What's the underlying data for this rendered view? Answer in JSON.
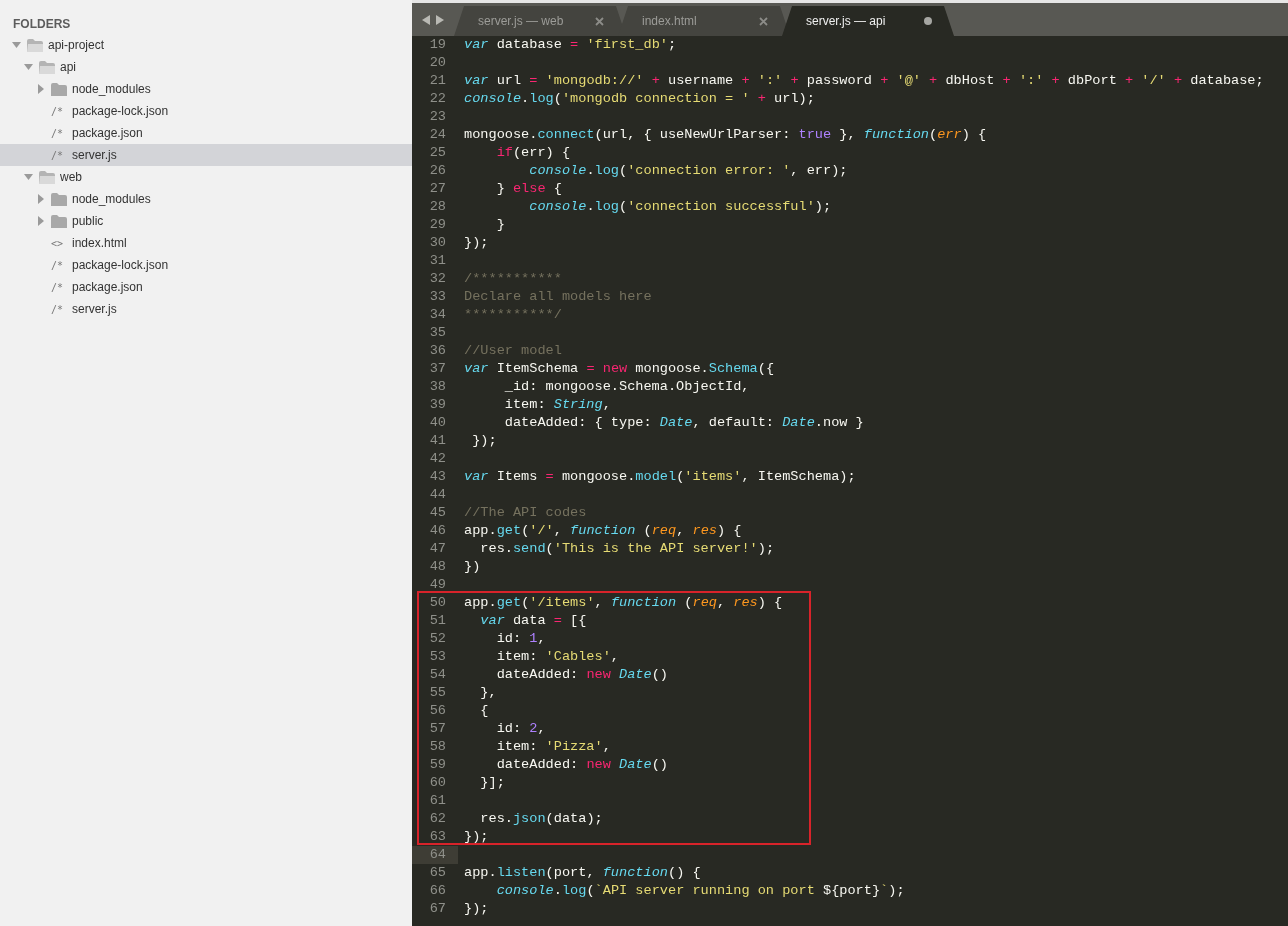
{
  "sidebar": {
    "heading": "FOLDERS",
    "tree": [
      {
        "label": "api-project",
        "kind": "folder",
        "expanded": true,
        "selected": false,
        "children": [
          {
            "label": "api",
            "kind": "folder",
            "expanded": true,
            "selected": false,
            "children": [
              {
                "label": "node_modules",
                "kind": "folder",
                "expanded": false,
                "selected": false
              },
              {
                "label": "package-lock.json",
                "kind": "file",
                "glyph": "/*",
                "selected": false
              },
              {
                "label": "package.json",
                "kind": "file",
                "glyph": "/*",
                "selected": false
              },
              {
                "label": "server.js",
                "kind": "file",
                "glyph": "/*",
                "selected": true
              }
            ]
          },
          {
            "label": "web",
            "kind": "folder",
            "expanded": true,
            "selected": false,
            "children": [
              {
                "label": "node_modules",
                "kind": "folder",
                "expanded": false,
                "selected": false
              },
              {
                "label": "public",
                "kind": "folder",
                "expanded": false,
                "selected": false
              },
              {
                "label": "index.html",
                "kind": "file",
                "glyph": "<>",
                "selected": false
              },
              {
                "label": "package-lock.json",
                "kind": "file",
                "glyph": "/*",
                "selected": false
              },
              {
                "label": "package.json",
                "kind": "file",
                "glyph": "/*",
                "selected": false
              },
              {
                "label": "server.js",
                "kind": "file",
                "glyph": "/*",
                "selected": false
              }
            ]
          }
        ]
      }
    ]
  },
  "tabs": [
    {
      "label": "server.js — web",
      "selected": false,
      "modified": false
    },
    {
      "label": "index.html",
      "selected": false,
      "modified": false
    },
    {
      "label": "server.js — api",
      "selected": true,
      "modified": true
    }
  ],
  "editor": {
    "lines": [
      {
        "number": "19",
        "current": false,
        "tokens": [
          {
            "text": "var",
            "kind": "storage"
          },
          {
            "text": " database ",
            "kind": "plain"
          },
          {
            "text": "=",
            "kind": "keyword"
          },
          {
            "text": " 'first_db'",
            "kind": "string"
          },
          {
            "text": ";",
            "kind": "plain"
          }
        ]
      },
      {
        "number": "20",
        "current": false
      },
      {
        "number": "21",
        "current": false,
        "tokens": [
          {
            "text": "var",
            "kind": "storage"
          },
          {
            "text": " url ",
            "kind": "plain"
          },
          {
            "text": "=",
            "kind": "keyword"
          },
          {
            "text": " 'mongodb://' ",
            "kind": "string"
          },
          {
            "text": "+",
            "kind": "keyword"
          },
          {
            "text": " username ",
            "kind": "plain"
          },
          {
            "text": "+",
            "kind": "keyword"
          },
          {
            "text": " ':' ",
            "kind": "string"
          },
          {
            "text": "+",
            "kind": "keyword"
          },
          {
            "text": " password ",
            "kind": "plain"
          },
          {
            "text": "+",
            "kind": "keyword"
          },
          {
            "text": " '@' ",
            "kind": "string"
          },
          {
            "text": "+",
            "kind": "keyword"
          },
          {
            "text": " dbHost ",
            "kind": "plain"
          },
          {
            "text": "+",
            "kind": "keyword"
          },
          {
            "text": " ':' ",
            "kind": "string"
          },
          {
            "text": "+",
            "kind": "keyword"
          },
          {
            "text": " dbPort ",
            "kind": "plain"
          },
          {
            "text": "+",
            "kind": "keyword"
          },
          {
            "text": " '/' ",
            "kind": "string"
          },
          {
            "text": "+",
            "kind": "keyword"
          },
          {
            "text": " database;",
            "kind": "plain"
          }
        ]
      },
      {
        "number": "22",
        "current": false,
        "tokens": [
          {
            "text": "console",
            "kind": "type"
          },
          {
            "text": ".",
            "kind": "plain"
          },
          {
            "text": "log",
            "kind": "support"
          },
          {
            "text": "(",
            "kind": "plain"
          },
          {
            "text": "'mongodb connection = ' ",
            "kind": "string"
          },
          {
            "text": "+",
            "kind": "keyword"
          },
          {
            "text": " url);",
            "kind": "plain"
          }
        ]
      },
      {
        "number": "23",
        "current": false
      },
      {
        "number": "24",
        "current": false,
        "tokens": [
          {
            "text": "mongoose.",
            "kind": "plain"
          },
          {
            "text": "connect",
            "kind": "support"
          },
          {
            "text": "(url, { useNewUrlParser: ",
            "kind": "plain"
          },
          {
            "text": "true",
            "kind": "constant"
          },
          {
            "text": " }, ",
            "kind": "plain"
          },
          {
            "text": "function",
            "kind": "type"
          },
          {
            "text": "(",
            "kind": "plain"
          },
          {
            "text": "err",
            "kind": "param"
          },
          {
            "text": ") {",
            "kind": "plain"
          }
        ]
      },
      {
        "number": "25",
        "current": false,
        "tokens": [
          {
            "text": "    if",
            "kind": "keyword"
          },
          {
            "text": "(err) {",
            "kind": "plain"
          }
        ]
      },
      {
        "number": "26",
        "current": false,
        "tokens": [
          {
            "text": "        console",
            "kind": "type"
          },
          {
            "text": ".",
            "kind": "plain"
          },
          {
            "text": "log",
            "kind": "support"
          },
          {
            "text": "(",
            "kind": "plain"
          },
          {
            "text": "'connection error: '",
            "kind": "string"
          },
          {
            "text": ", err);",
            "kind": "plain"
          }
        ]
      },
      {
        "number": "27",
        "current": false,
        "tokens": [
          {
            "text": "    } ",
            "kind": "plain"
          },
          {
            "text": "else",
            "kind": "keyword"
          },
          {
            "text": " {",
            "kind": "plain"
          }
        ]
      },
      {
        "number": "28",
        "current": false,
        "tokens": [
          {
            "text": "        console",
            "kind": "type"
          },
          {
            "text": ".",
            "kind": "plain"
          },
          {
            "text": "log",
            "kind": "support"
          },
          {
            "text": "(",
            "kind": "plain"
          },
          {
            "text": "'connection successful'",
            "kind": "string"
          },
          {
            "text": ");",
            "kind": "plain"
          }
        ]
      },
      {
        "number": "29",
        "current": false,
        "tokens": [
          {
            "text": "    }",
            "kind": "plain"
          }
        ]
      },
      {
        "number": "30",
        "current": false,
        "tokens": [
          {
            "text": "});",
            "kind": "plain"
          }
        ]
      },
      {
        "number": "31",
        "current": false
      },
      {
        "number": "32",
        "current": false,
        "tokens": [
          {
            "text": "/***********",
            "kind": "comment"
          }
        ]
      },
      {
        "number": "33",
        "current": false,
        "tokens": [
          {
            "text": "Declare all models here",
            "kind": "comment"
          }
        ]
      },
      {
        "number": "34",
        "current": false,
        "tokens": [
          {
            "text": "***********/",
            "kind": "comment"
          }
        ]
      },
      {
        "number": "35",
        "current": false
      },
      {
        "number": "36",
        "current": false,
        "tokens": [
          {
            "text": "//User model",
            "kind": "comment"
          }
        ]
      },
      {
        "number": "37",
        "current": false,
        "tokens": [
          {
            "text": "var",
            "kind": "storage"
          },
          {
            "text": " ItemSchema ",
            "kind": "plain"
          },
          {
            "text": "=",
            "kind": "keyword"
          },
          {
            "text": " new",
            "kind": "keyword"
          },
          {
            "text": " mongoose.",
            "kind": "plain"
          },
          {
            "text": "Schema",
            "kind": "support"
          },
          {
            "text": "({",
            "kind": "plain"
          }
        ]
      },
      {
        "number": "38",
        "current": false,
        "tokens": [
          {
            "text": "     _id: mongoose.Schema.ObjectId,",
            "kind": "plain"
          }
        ]
      },
      {
        "number": "39",
        "current": false,
        "tokens": [
          {
            "text": "     item: ",
            "kind": "plain"
          },
          {
            "text": "String",
            "kind": "type"
          },
          {
            "text": ",",
            "kind": "plain"
          }
        ]
      },
      {
        "number": "40",
        "current": false,
        "tokens": [
          {
            "text": "     dateAdded: { type: ",
            "kind": "plain"
          },
          {
            "text": "Date",
            "kind": "type"
          },
          {
            "text": ", default: ",
            "kind": "plain"
          },
          {
            "text": "Date",
            "kind": "type"
          },
          {
            "text": ".now }",
            "kind": "plain"
          }
        ]
      },
      {
        "number": "41",
        "current": false,
        "tokens": [
          {
            "text": " });",
            "kind": "plain"
          }
        ]
      },
      {
        "number": "42",
        "current": false
      },
      {
        "number": "43",
        "current": false,
        "tokens": [
          {
            "text": "var",
            "kind": "storage"
          },
          {
            "text": " Items ",
            "kind": "plain"
          },
          {
            "text": "=",
            "kind": "keyword"
          },
          {
            "text": " mongoose.",
            "kind": "plain"
          },
          {
            "text": "model",
            "kind": "support"
          },
          {
            "text": "(",
            "kind": "plain"
          },
          {
            "text": "'items'",
            "kind": "string"
          },
          {
            "text": ", ItemSchema);",
            "kind": "plain"
          }
        ]
      },
      {
        "number": "44",
        "current": false
      },
      {
        "number": "45",
        "current": false,
        "tokens": [
          {
            "text": "//The API codes",
            "kind": "comment"
          }
        ]
      },
      {
        "number": "46",
        "current": false,
        "tokens": [
          {
            "text": "app.",
            "kind": "plain"
          },
          {
            "text": "get",
            "kind": "support"
          },
          {
            "text": "(",
            "kind": "plain"
          },
          {
            "text": "'/'",
            "kind": "string"
          },
          {
            "text": ", ",
            "kind": "plain"
          },
          {
            "text": "function",
            "kind": "type"
          },
          {
            "text": " (",
            "kind": "plain"
          },
          {
            "text": "req",
            "kind": "param"
          },
          {
            "text": ", ",
            "kind": "plain"
          },
          {
            "text": "res",
            "kind": "param"
          },
          {
            "text": ") {",
            "kind": "plain"
          }
        ]
      },
      {
        "number": "47",
        "current": false,
        "tokens": [
          {
            "text": "  res.",
            "kind": "plain"
          },
          {
            "text": "send",
            "kind": "support"
          },
          {
            "text": "(",
            "kind": "plain"
          },
          {
            "text": "'This is the API server!'",
            "kind": "string"
          },
          {
            "text": ");",
            "kind": "plain"
          }
        ]
      },
      {
        "number": "48",
        "current": false,
        "tokens": [
          {
            "text": "})",
            "kind": "plain"
          }
        ]
      },
      {
        "number": "49",
        "current": false
      },
      {
        "number": "50",
        "current": false,
        "tokens": [
          {
            "text": "app.",
            "kind": "plain"
          },
          {
            "text": "get",
            "kind": "support"
          },
          {
            "text": "(",
            "kind": "plain"
          },
          {
            "text": "'/items'",
            "kind": "string"
          },
          {
            "text": ", ",
            "kind": "plain"
          },
          {
            "text": "function",
            "kind": "type"
          },
          {
            "text": " (",
            "kind": "plain"
          },
          {
            "text": "req",
            "kind": "param"
          },
          {
            "text": ", ",
            "kind": "plain"
          },
          {
            "text": "res",
            "kind": "param"
          },
          {
            "text": ") {",
            "kind": "plain"
          }
        ]
      },
      {
        "number": "51",
        "current": false,
        "tokens": [
          {
            "text": "  var",
            "kind": "storage"
          },
          {
            "text": " data ",
            "kind": "plain"
          },
          {
            "text": "=",
            "kind": "keyword"
          },
          {
            "text": " [{",
            "kind": "plain"
          }
        ]
      },
      {
        "number": "52",
        "current": false,
        "tokens": [
          {
            "text": "    id: ",
            "kind": "plain"
          },
          {
            "text": "1",
            "kind": "constant"
          },
          {
            "text": ",",
            "kind": "plain"
          }
        ]
      },
      {
        "number": "53",
        "current": false,
        "tokens": [
          {
            "text": "    item: ",
            "kind": "plain"
          },
          {
            "text": "'Cables'",
            "kind": "string"
          },
          {
            "text": ",",
            "kind": "plain"
          }
        ]
      },
      {
        "number": "54",
        "current": false,
        "tokens": [
          {
            "text": "    dateAdded: ",
            "kind": "plain"
          },
          {
            "text": "new",
            "kind": "keyword"
          },
          {
            "text": " Date",
            "kind": "type"
          },
          {
            "text": "()",
            "kind": "plain"
          }
        ]
      },
      {
        "number": "55",
        "current": false,
        "tokens": [
          {
            "text": "  },",
            "kind": "plain"
          }
        ]
      },
      {
        "number": "56",
        "current": false,
        "tokens": [
          {
            "text": "  {",
            "kind": "plain"
          }
        ]
      },
      {
        "number": "57",
        "current": false,
        "tokens": [
          {
            "text": "    id: ",
            "kind": "plain"
          },
          {
            "text": "2",
            "kind": "constant"
          },
          {
            "text": ",",
            "kind": "plain"
          }
        ]
      },
      {
        "number": "58",
        "current": false,
        "tokens": [
          {
            "text": "    item: ",
            "kind": "plain"
          },
          {
            "text": "'Pizza'",
            "kind": "string"
          },
          {
            "text": ",",
            "kind": "plain"
          }
        ]
      },
      {
        "number": "59",
        "current": false,
        "tokens": [
          {
            "text": "    dateAdded: ",
            "kind": "plain"
          },
          {
            "text": "new",
            "kind": "keyword"
          },
          {
            "text": " Date",
            "kind": "type"
          },
          {
            "text": "()",
            "kind": "plain"
          }
        ]
      },
      {
        "number": "60",
        "current": false,
        "tokens": [
          {
            "text": "  }];",
            "kind": "plain"
          }
        ]
      },
      {
        "number": "61",
        "current": false
      },
      {
        "number": "62",
        "current": false,
        "tokens": [
          {
            "text": "  res.",
            "kind": "plain"
          },
          {
            "text": "json",
            "kind": "support"
          },
          {
            "text": "(data);",
            "kind": "plain"
          }
        ]
      },
      {
        "number": "63",
        "current": false,
        "tokens": [
          {
            "text": "});",
            "kind": "plain"
          }
        ]
      },
      {
        "number": "64",
        "current": true
      },
      {
        "number": "65",
        "current": false,
        "tokens": [
          {
            "text": "app.",
            "kind": "plain"
          },
          {
            "text": "listen",
            "kind": "support"
          },
          {
            "text": "(port, ",
            "kind": "plain"
          },
          {
            "text": "function",
            "kind": "type"
          },
          {
            "text": "() {",
            "kind": "plain"
          }
        ]
      },
      {
        "number": "66",
        "current": false,
        "tokens": [
          {
            "text": "    console",
            "kind": "type"
          },
          {
            "text": ".",
            "kind": "plain"
          },
          {
            "text": "log",
            "kind": "support"
          },
          {
            "text": "(",
            "kind": "plain"
          },
          {
            "text": "`API server running on port ",
            "kind": "string"
          },
          {
            "text": "${port}",
            "kind": "plain"
          },
          {
            "text": "`",
            "kind": "string"
          },
          {
            "text": ");",
            "kind": "plain"
          }
        ]
      },
      {
        "number": "67",
        "current": false,
        "tokens": [
          {
            "text": "});",
            "kind": "plain"
          }
        ]
      }
    ],
    "annotations": [
      {
        "kind": "rectangle"
      }
    ]
  }
}
